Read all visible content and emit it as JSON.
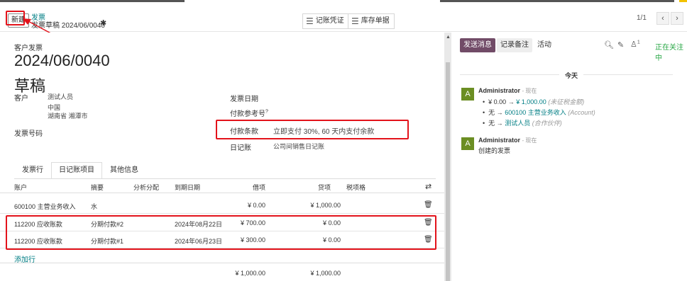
{
  "control": {
    "new_label": "新建",
    "breadcrumb_parent": "发票",
    "breadcrumb_current": "发票草稿 2024/06/0040",
    "smart_buttons": [
      {
        "label": "记账凭证"
      },
      {
        "label": "库存单据"
      }
    ],
    "pager": "1/1"
  },
  "invoice": {
    "kind": "客户发票",
    "number": "2024/06/0040",
    "state": "草稿",
    "customer_label": "客户",
    "customer_name": "测试人员",
    "customer_country": "中国",
    "customer_region": "湖南省 湘潭市",
    "ref_label": "发票号码",
    "invoice_date_label": "发票日期",
    "payment_ref_label": "付款参考号",
    "payment_ref_sup": "?",
    "payment_terms_label": "付款条款",
    "payment_terms_value": "立即支付 30%, 60 天内支付余款",
    "journal_label": "日记账",
    "journal_value": "公司间销售日记账"
  },
  "tabs": [
    {
      "label": "发票行",
      "active": false
    },
    {
      "label": "日记账项目",
      "active": true
    },
    {
      "label": "其他信息",
      "active": false
    }
  ],
  "table": {
    "columns": {
      "account": "账户",
      "label": "摘要",
      "analytic": "分析分配",
      "due": "到期日期",
      "debit": "借项",
      "credit": "贷项",
      "tax": "税项格"
    },
    "rows": [
      {
        "account": "600100 主营业务收入",
        "label": "水",
        "due": "",
        "debit": "¥ 0.00",
        "credit": "¥ 1,000.00"
      },
      {
        "account": "112200 应收账款",
        "label": "分期付款#2",
        "due": "2024年08月22日",
        "debit": "¥ 700.00",
        "credit": "¥ 0.00"
      },
      {
        "account": "112200 应收账款",
        "label": "分期付款#1",
        "due": "2024年06月23日",
        "debit": "¥ 300.00",
        "credit": "¥ 0.00"
      }
    ],
    "add_line": "添加行",
    "total_debit": "¥ 1,000.00",
    "total_credit": "¥ 1,000.00"
  },
  "chatter": {
    "send_message": "发送消息",
    "log_note": "记录备注",
    "activity": "活动",
    "followers_count": "1",
    "following": "正在关注中",
    "today": "今天",
    "messages": [
      {
        "avatar": "A",
        "author": "Administrator",
        "time": "- 现在",
        "changes": [
          {
            "old": "¥ 0.00",
            "new": "¥ 1,000.00",
            "field": "(未征税金额)"
          },
          {
            "old": "无",
            "new": "600100 主营业务收入",
            "field": "(Account)"
          },
          {
            "old": "无",
            "new": "测试人员",
            "field": "(合作伙伴)"
          }
        ]
      },
      {
        "avatar": "A",
        "author": "Administrator",
        "time": "- 现在",
        "body": "创建的发票"
      }
    ]
  },
  "colors": {
    "accent": "#017e84",
    "primary": "#714b67",
    "annotation": "#e3131b"
  }
}
